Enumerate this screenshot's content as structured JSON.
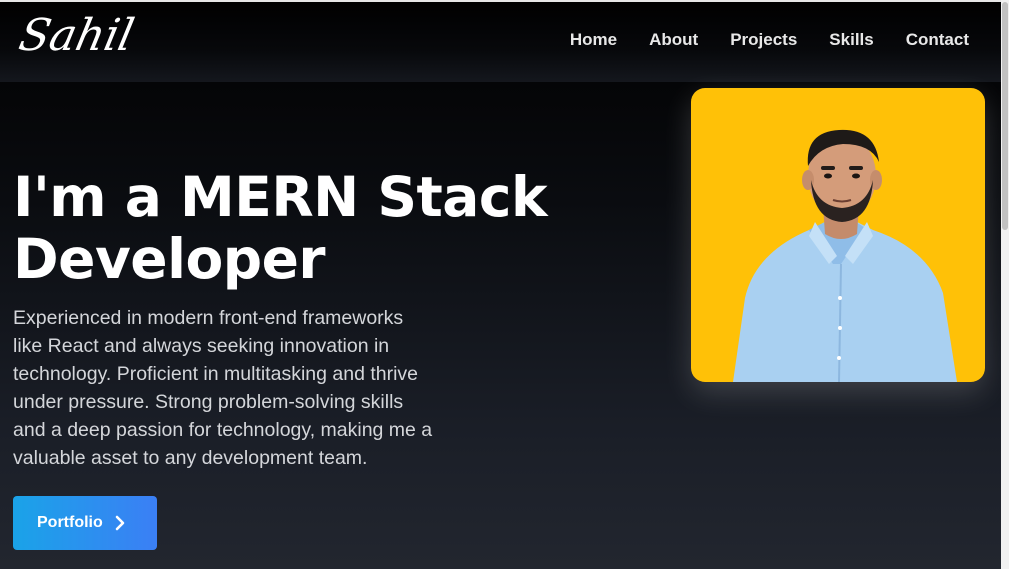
{
  "brand": {
    "logo_text": "Sahil"
  },
  "nav": {
    "items": [
      {
        "label": "Home"
      },
      {
        "label": "About"
      },
      {
        "label": "Projects"
      },
      {
        "label": "Skills"
      },
      {
        "label": "Contact"
      }
    ]
  },
  "hero": {
    "headline_line1": "I'm a MERN Stack",
    "headline_line2": "Developer",
    "description_lines": [
      "Experienced in modern front-end frameworks",
      "like React and always seeking innovation in",
      "technology. Proficient in multitasking and thrive",
      "under pressure. Strong problem-solving skills",
      "and a deep passion for technology, making me a",
      "valuable asset to any development team."
    ],
    "cta_label": "Portfolio",
    "cta_icon": "chevron-right-icon"
  },
  "photo": {
    "subject": "profile-photo",
    "background_color": "#ffc107"
  },
  "colors": {
    "accent_start": "#1aa3e8",
    "accent_end": "#3b7ff5",
    "background": "#000000"
  }
}
